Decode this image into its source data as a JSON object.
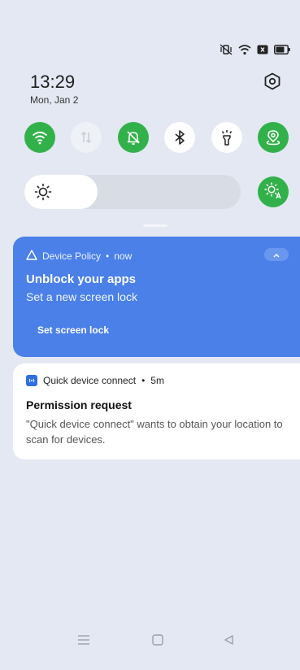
{
  "status_bar": {
    "icons": [
      "vibrate-icon",
      "wifi-icon",
      "sim-icon",
      "battery-icon"
    ]
  },
  "header": {
    "time": "13:29",
    "date": "Mon, Jan 2",
    "settings_icon": "settings-icon"
  },
  "quick_settings": {
    "tiles": [
      {
        "icon": "wifi-icon",
        "state": "on"
      },
      {
        "icon": "mobile-data-icon",
        "state": "off"
      },
      {
        "icon": "notifications-off-icon",
        "state": "on"
      },
      {
        "icon": "bluetooth-icon",
        "state": "off"
      },
      {
        "icon": "flashlight-icon",
        "state": "off"
      },
      {
        "icon": "location-icon",
        "state": "on"
      }
    ],
    "brightness": {
      "level": 0.34,
      "auto": true
    }
  },
  "notifications": [
    {
      "app": "Device Policy",
      "time": "now",
      "title": "Unblock your apps",
      "text": "Set a new screen lock",
      "action": "Set screen lock"
    },
    {
      "app": "Quick device connect",
      "time": "5m",
      "title": "Permission request",
      "text": "\"Quick device connect\" wants to obtain your location to scan for devices."
    }
  ],
  "nav_bar": {
    "buttons": [
      "menu-icon",
      "home-icon",
      "back-icon"
    ]
  },
  "colors": {
    "accent_green": "#32b14a",
    "policy_card": "#4a80e8",
    "background": "#e3e8f2"
  }
}
